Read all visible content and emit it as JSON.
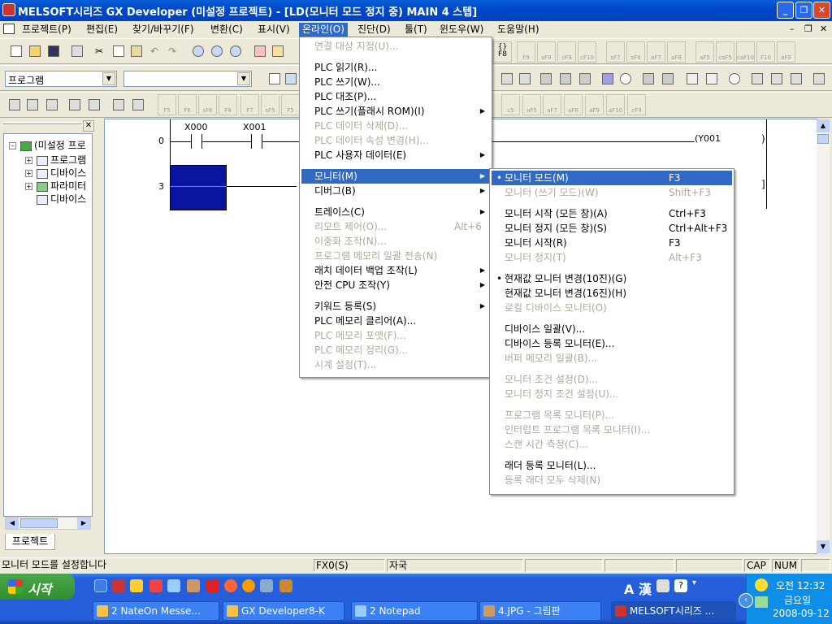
{
  "window": {
    "title": "MELSOFT시리즈 GX Developer (미설정 프로젝트) - [LD(모니터 모드 정지 중)    MAIN    4 스텝]"
  },
  "menubar": {
    "items": [
      "프로젝트(P)",
      "편집(E)",
      "찾기/바꾸기(F)",
      "변환(C)",
      "표시(V)",
      "온라인(O)",
      "진단(D)",
      "툴(T)",
      "윈도우(W)",
      "도움말(H)"
    ]
  },
  "toolbar": {
    "program_combo": "프로그램",
    "second_combo": ""
  },
  "project_pane": {
    "root_label": "(미설정 프로",
    "items": [
      "프로그램",
      "디바이스",
      "파라미터",
      "디바이스"
    ],
    "tab": "프로젝트"
  },
  "ladder": {
    "step0": "0",
    "step3": "3",
    "contact1": "X000",
    "contact2": "X001",
    "coil": "Y001"
  },
  "online_menu": {
    "items": [
      {
        "label": "연결 대상 지정(U)...",
        "disabled": true
      },
      {
        "sep": true
      },
      {
        "label": "PLC 읽기(R)...",
        "disabled": false
      },
      {
        "label": "PLC 쓰기(W)...",
        "disabled": false
      },
      {
        "label": "PLC 대조(P)...",
        "disabled": false
      },
      {
        "label": "PLC 쓰기(플래시 ROM)(I)",
        "disabled": false,
        "sub": true
      },
      {
        "label": "PLC 데이터 삭제(D)...",
        "disabled": true
      },
      {
        "label": "PLC 데이터 속성 변경(H)...",
        "disabled": true
      },
      {
        "label": "PLC 사용자 데이터(E)",
        "disabled": false,
        "sub": true
      },
      {
        "sep": true
      },
      {
        "label": "모니터(M)",
        "disabled": false,
        "sub": true,
        "highlight": true
      },
      {
        "label": "디버그(B)",
        "disabled": false,
        "sub": true
      },
      {
        "sep": true
      },
      {
        "label": "트레이스(C)",
        "disabled": false,
        "sub": true
      },
      {
        "label": "리모트 제어(O)...",
        "disabled": true,
        "shortcut": "Alt+6"
      },
      {
        "label": "이중화 조작(N)...",
        "disabled": true
      },
      {
        "label": "프로그램 메모리 일괄 전송(N)",
        "disabled": true
      },
      {
        "label": "래치 데이터 백업 조작(L)",
        "disabled": false,
        "sub": true
      },
      {
        "label": "안전 CPU 조작(Y)",
        "disabled": false,
        "sub": true
      },
      {
        "sep": true
      },
      {
        "label": "키워드 등록(S)",
        "disabled": false,
        "sub": true
      },
      {
        "label": "PLC 메모리 클리어(A)...",
        "disabled": false
      },
      {
        "label": "PLC 메모리 포맷(F)...",
        "disabled": true
      },
      {
        "label": "PLC 메모리 정리(G)...",
        "disabled": true
      },
      {
        "label": "시계 설정(T)...",
        "disabled": true
      }
    ]
  },
  "monitor_menu": {
    "items": [
      {
        "label": "모니터 모드(M)",
        "shortcut": "F3",
        "bullet": true,
        "highlight": true,
        "disabled": false
      },
      {
        "label": "모니터 (쓰기 모드)(W)",
        "shortcut": "Shift+F3",
        "disabled": true
      },
      {
        "sep": true
      },
      {
        "label": "모니터 시작 (모든 창)(A)",
        "shortcut": "Ctrl+F3",
        "disabled": false
      },
      {
        "label": "모니터 정지 (모든 창)(S)",
        "shortcut": "Ctrl+Alt+F3",
        "disabled": false
      },
      {
        "label": "모니터 시작(R)",
        "shortcut": "F3",
        "disabled": false
      },
      {
        "label": "모니터 정지(T)",
        "shortcut": "Alt+F3",
        "disabled": true
      },
      {
        "sep": true
      },
      {
        "label": "현재값 모니터 변경(10진)(G)",
        "bullet": true,
        "disabled": false
      },
      {
        "label": "현재값 모니터 변경(16진)(H)",
        "disabled": false
      },
      {
        "label": "로컬 디바이스 모니터(O)",
        "disabled": true
      },
      {
        "sep": true
      },
      {
        "label": "디바이스 일괄(V)...",
        "disabled": false
      },
      {
        "label": "디바이스 등록 모니터(E)...",
        "disabled": false
      },
      {
        "label": "버퍼 메모리 일괄(B)...",
        "disabled": true
      },
      {
        "sep": true
      },
      {
        "label": "모니터 조건 설정(D)...",
        "disabled": true
      },
      {
        "label": "모니터 정지 조건 설정(U)...",
        "disabled": true
      },
      {
        "sep": true
      },
      {
        "label": "프로그램 목록 모니터(P)...",
        "disabled": true
      },
      {
        "label": "인터럽트 프로그램 목록 모니터(I)...",
        "disabled": true
      },
      {
        "label": "스캔 시간 측정(C)...",
        "disabled": true
      },
      {
        "sep": true
      },
      {
        "label": "래더 등록 모니터(L)...",
        "disabled": false
      },
      {
        "label": "등록 래더 모두 삭제(N)",
        "disabled": true
      }
    ]
  },
  "statusbar": {
    "message": "모니터 모드를 설정합니다",
    "plc": "FX0(S)",
    "station": "자국",
    "cap": "CAP",
    "num": "NUM"
  },
  "taskbar": {
    "start": "시작",
    "tasks": [
      "2 NateOn Messe...",
      "GX Developer8-K",
      "2 Notepad",
      "4.JPG - 그림판",
      "MELSOFT시리즈 ..."
    ],
    "lang": "A 漢",
    "time": "오전 12:32",
    "day": "금요일",
    "date": "2008-09-12"
  }
}
